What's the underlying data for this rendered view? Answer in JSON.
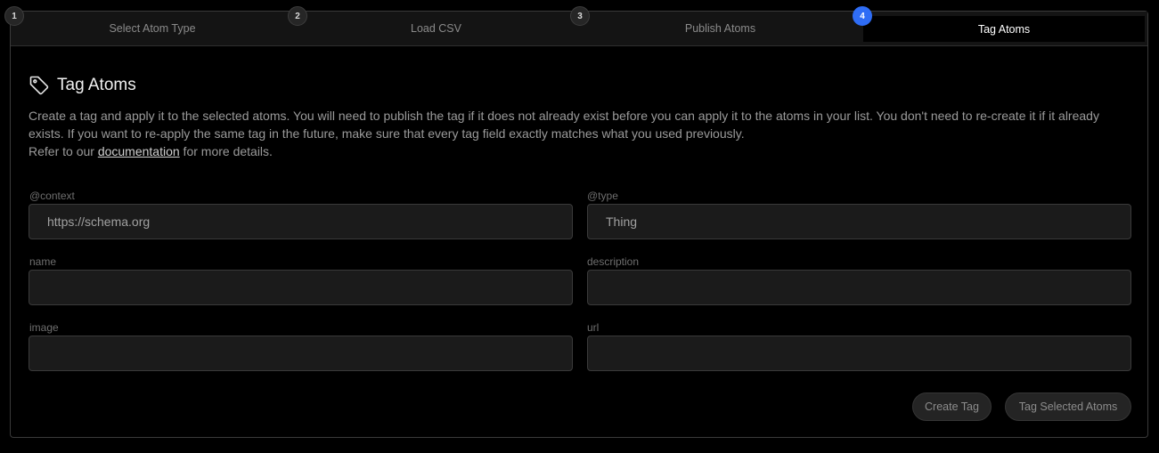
{
  "steps": [
    {
      "number": "1",
      "label": "Select Atom Type"
    },
    {
      "number": "2",
      "label": "Load CSV"
    },
    {
      "number": "3",
      "label": "Publish Atoms"
    },
    {
      "number": "4",
      "label": "Tag Atoms",
      "active": true
    }
  ],
  "section": {
    "icon": "tag-icon",
    "title": "Tag Atoms",
    "description_line1": "Create a tag and apply it to the selected atoms. You will need to publish the tag if it does not already exist before you can apply it to the atoms in your list. You don't need to re-create it if it already exists. If you want to re-apply the same tag in the future, make sure that every tag field exactly matches what you used previously.",
    "refer_prefix": "Refer to our ",
    "doc_link": "documentation",
    "refer_suffix": " for more details."
  },
  "fields": {
    "context": {
      "label": "@context",
      "value": "https://schema.org"
    },
    "type": {
      "label": "@type",
      "value": "Thing"
    },
    "name": {
      "label": "name",
      "value": ""
    },
    "description": {
      "label": "description",
      "value": ""
    },
    "image": {
      "label": "image",
      "value": ""
    },
    "url": {
      "label": "url",
      "value": ""
    }
  },
  "buttons": {
    "create_tag": "Create Tag",
    "tag_selected": "Tag Selected Atoms"
  },
  "colors": {
    "accent": "#2f6df5",
    "background": "#000000",
    "input_bg": "#1b1b1b"
  }
}
